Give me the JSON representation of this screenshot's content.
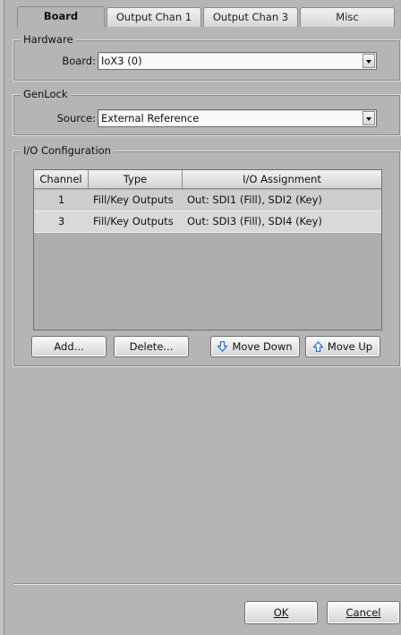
{
  "tabs": [
    {
      "label": "Board",
      "active": true
    },
    {
      "label": "Output Chan 1",
      "active": false
    },
    {
      "label": "Output Chan 3",
      "active": false
    },
    {
      "label": "Misc",
      "active": false
    }
  ],
  "hardware": {
    "title": "Hardware",
    "board_label": "Board:",
    "board_value": "IoX3 (0)"
  },
  "genlock": {
    "title": "GenLock",
    "source_label": "Source:",
    "source_value": "External Reference"
  },
  "io": {
    "title": "I/O Configuration",
    "columns": [
      "Channel",
      "Type",
      "I/O Assignment"
    ],
    "rows": [
      {
        "channel": "1",
        "type": "Fill/Key Outputs",
        "assignment": "Out: SDI1 (Fill), SDI2 (Key)"
      },
      {
        "channel": "3",
        "type": "Fill/Key Outputs",
        "assignment": "Out: SDI3 (Fill), SDI4 (Key)"
      }
    ],
    "add_label": "Add...",
    "delete_label": "Delete...",
    "move_down_label": "Move Down",
    "move_up_label": "Move Up"
  },
  "dialog": {
    "ok_label": "OK",
    "cancel_label": "Cancel"
  },
  "colors": {
    "arrow_blue": "#2f6fd6"
  }
}
